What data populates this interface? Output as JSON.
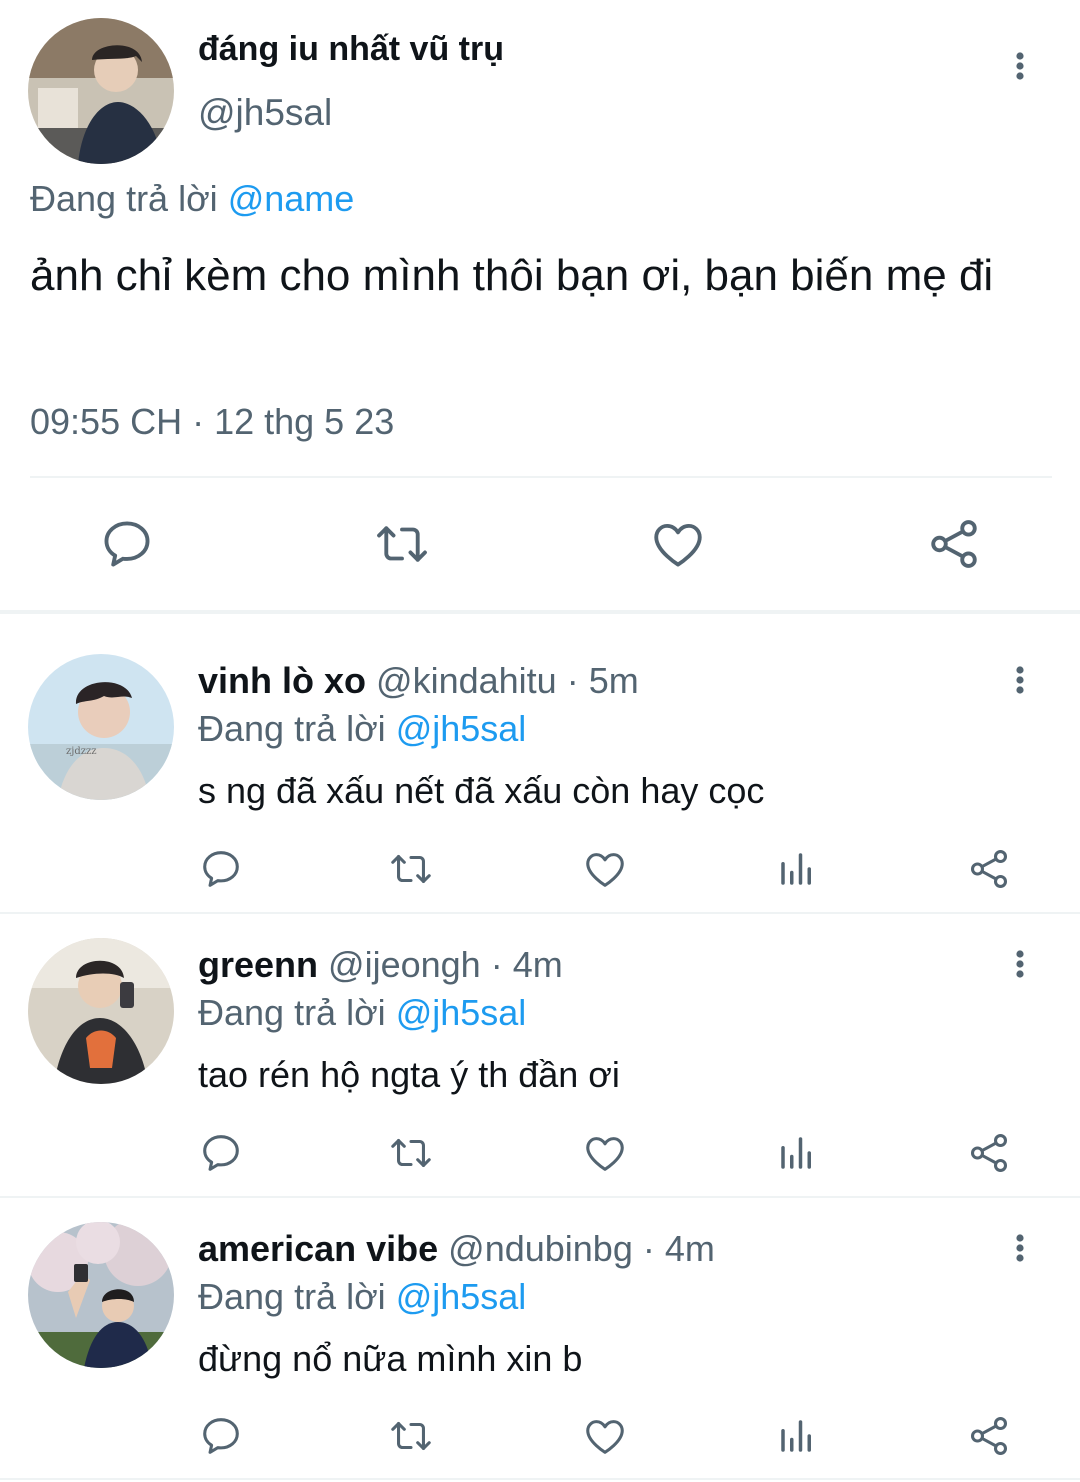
{
  "main_tweet": {
    "display_name": "đáng iu nhất vũ trụ",
    "handle": "@jh5sal",
    "replying_prefix": "Đang trả lời",
    "replying_to": "@name",
    "text": "ảnh chỉ kèm cho mình thôi bạn ơi, bạn biến mẹ đi",
    "timestamp": "09:55 CH · 12 thg 5 23",
    "avatar_icon": "avatar-photo",
    "actions": [
      "reply-icon",
      "retweet-icon",
      "like-icon",
      "share-icon"
    ]
  },
  "replies": [
    {
      "display_name": "vinh lò xo",
      "handle": "@kindahitu",
      "separator": " · ",
      "time": "5m",
      "replying_prefix": "Đang trả lời",
      "replying_to": "@jh5sal",
      "text": "s ng đã xấu nết đã xấu còn hay cọc",
      "avatar_watermark": "zjdzzz"
    },
    {
      "display_name": "greenn",
      "handle": "@ijeongh",
      "separator": " · ",
      "time": "4m",
      "replying_prefix": "Đang trả lời",
      "replying_to": "@jh5sal",
      "text": "tao rén hộ ngta ý th đần ơi"
    },
    {
      "display_name": "american vibe",
      "handle": "@ndubinbg",
      "separator": " · ",
      "time": "4m",
      "replying_prefix": "Đang trả lời",
      "replying_to": "@jh5sal",
      "text": "đừng nổ nữa mình xin b"
    }
  ],
  "colors": {
    "text_primary": "#0f1419",
    "text_secondary": "#536471",
    "accent": "#1d9bf0",
    "divider": "#eff3f4",
    "icon": "#536471"
  }
}
